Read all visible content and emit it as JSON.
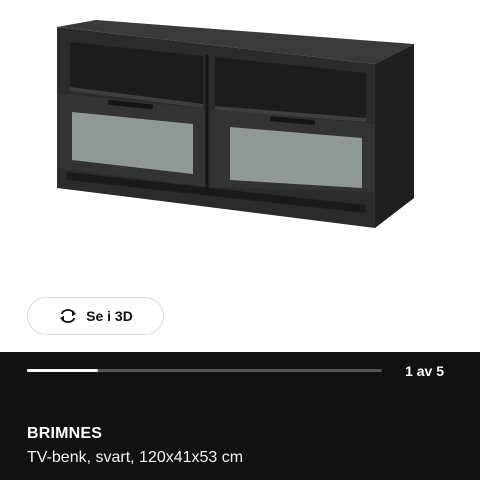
{
  "viewer": {
    "button_label": "Se i 3D",
    "button_icon": "rotate-3d-icon"
  },
  "gallery": {
    "current": 1,
    "total": 5,
    "pager_text": "1 av 5",
    "progress": 0.2
  },
  "product": {
    "name": "BRIMNES",
    "description": "TV-benk, svart, 120x41x53 cm",
    "colors": {
      "body": "#2b2b2b",
      "glass": "#8f9a96"
    }
  }
}
